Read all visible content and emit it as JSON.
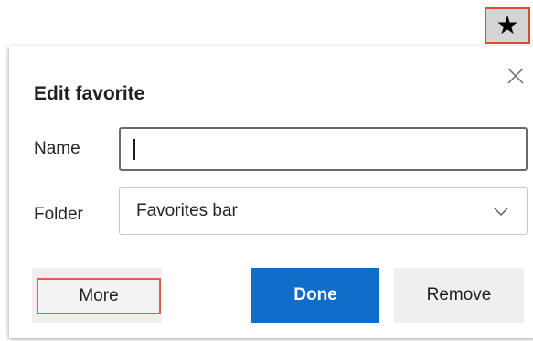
{
  "toolbar": {
    "favorite_icon": "star-icon",
    "favorite_glyph": "★"
  },
  "dialog": {
    "title": "Edit favorite",
    "close_icon": "close-icon",
    "name": {
      "label": "Name",
      "value": "",
      "placeholder": ""
    },
    "folder": {
      "label": "Folder",
      "selected": "Favorites bar",
      "dropdown_icon": "chevron-down-icon"
    },
    "buttons": {
      "more": "More",
      "done": "Done",
      "remove": "Remove"
    }
  },
  "colors": {
    "primary": "#0f6cc9",
    "highlight": "#e04a33",
    "secondary_button": "#efefef"
  }
}
